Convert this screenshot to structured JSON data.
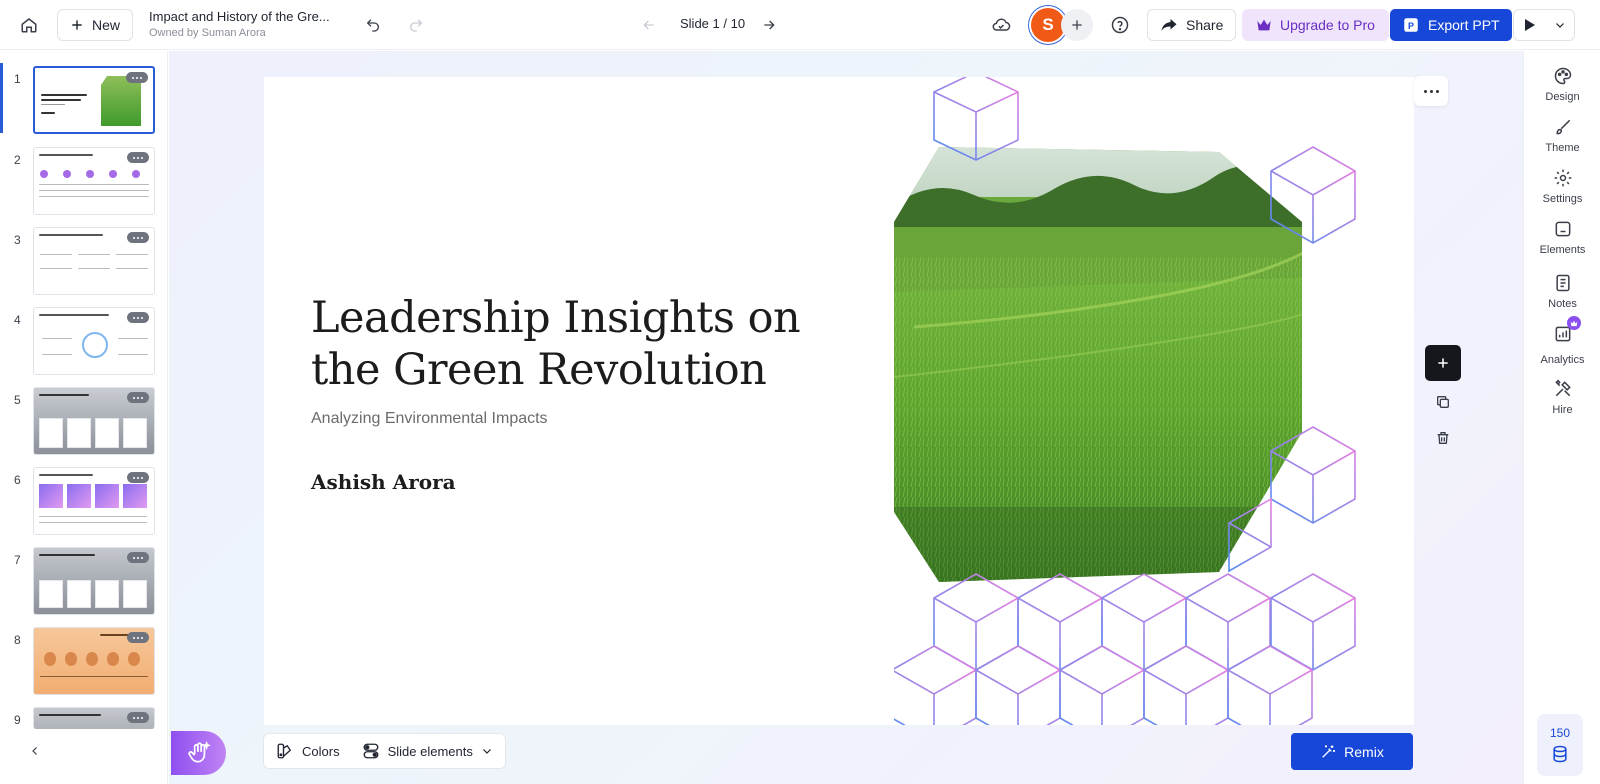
{
  "topbar": {
    "new_label": "New",
    "doc_title": "Impact and History of the Gre...",
    "doc_owner": "Owned by Suman Arora",
    "slide_counter": "Slide 1 / 10",
    "avatar_letter": "S",
    "share_label": "Share",
    "upgrade_label": "Upgrade to Pro",
    "export_label": "Export PPT"
  },
  "sidebar": {
    "thumbnails": [
      {
        "number": "1",
        "active": true
      },
      {
        "number": "2"
      },
      {
        "number": "3"
      },
      {
        "number": "4"
      },
      {
        "number": "5"
      },
      {
        "number": "6"
      },
      {
        "number": "7"
      },
      {
        "number": "8"
      },
      {
        "number": "9"
      }
    ]
  },
  "slide": {
    "title": "Leadership Insights on the Green Revolution",
    "subtitle": "Analyzing Environmental Impacts",
    "author": "Ashish Arora"
  },
  "rail": {
    "items": [
      {
        "label": "Design",
        "icon": "palette-icon"
      },
      {
        "label": "Theme",
        "icon": "brush-icon"
      },
      {
        "label": "Settings",
        "icon": "gear-icon"
      },
      {
        "label": "Elements",
        "icon": "elements-icon"
      },
      {
        "label": "Notes",
        "icon": "notes-icon"
      },
      {
        "label": "Analytics",
        "icon": "analytics-icon"
      },
      {
        "label": "Hire",
        "icon": "tools-icon"
      }
    ],
    "credits": "150"
  },
  "bottom": {
    "colors_label": "Colors",
    "elements_label": "Slide elements",
    "remix_label": "Remix"
  },
  "colors": {
    "accent": "#1747d8",
    "upgrade_bg": "#efe4fb",
    "avatar": "#f05a16",
    "hex_blue": "#4d8bf0",
    "hex_pink": "#e87fe0"
  }
}
